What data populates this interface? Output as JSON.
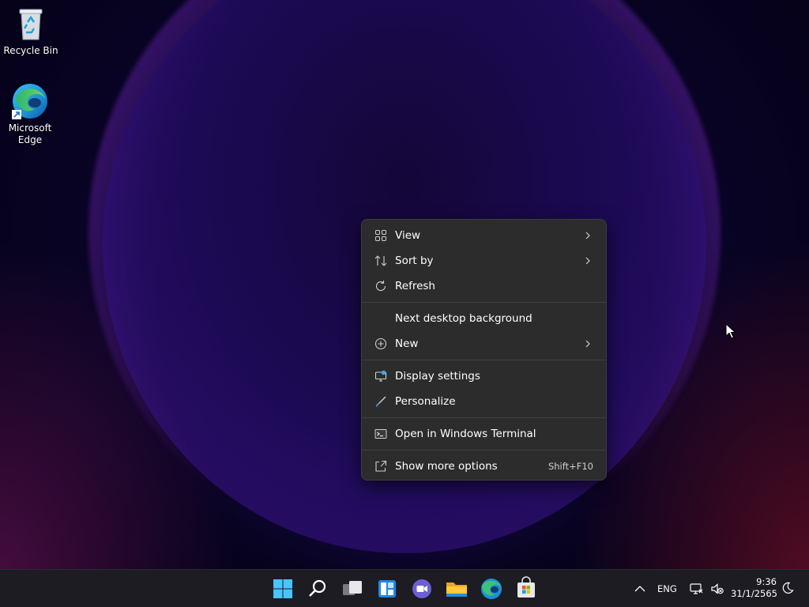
{
  "desktop": {
    "icons": [
      {
        "label": "Recycle Bin"
      },
      {
        "label": "Microsoft Edge"
      }
    ]
  },
  "context_menu": {
    "items": [
      {
        "label": "View",
        "icon": "view-grid-icon",
        "submenu": true
      },
      {
        "label": "Sort by",
        "icon": "sort-icon",
        "submenu": true
      },
      {
        "label": "Refresh",
        "icon": "refresh-icon"
      },
      {
        "label": "Next desktop background"
      },
      {
        "label": "New",
        "icon": "plus-circle-icon",
        "submenu": true
      },
      {
        "label": "Display settings",
        "icon": "display-icon"
      },
      {
        "label": "Personalize",
        "icon": "brush-icon"
      },
      {
        "label": "Open in Windows Terminal",
        "icon": "terminal-icon"
      },
      {
        "label": "Show more options",
        "icon": "share-icon",
        "shortcut": "Shift+F10"
      }
    ]
  },
  "taskbar": {
    "apps": [
      "start-icon",
      "search-icon",
      "task-view-icon",
      "widgets-icon",
      "chat-icon",
      "file-explorer-icon",
      "edge-icon",
      "store-icon"
    ],
    "tray": {
      "language": "ENG",
      "time": "9:36",
      "date": "31/1/2565"
    }
  }
}
